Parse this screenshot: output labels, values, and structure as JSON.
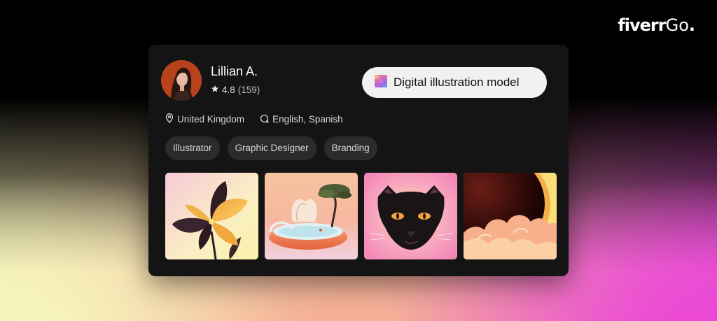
{
  "brand": {
    "name": "fiverr",
    "suffix": "Go",
    "dot": "."
  },
  "profile": {
    "name": "Lillian A.",
    "rating": "4.8",
    "reviews": "(159)",
    "location": "United Kingdom",
    "languages": "English, Spanish",
    "tags": [
      "Illustrator",
      "Graphic Designer",
      "Branding"
    ]
  },
  "cta": {
    "label": "Digital illustration model",
    "icon": "model-gradient-icon"
  },
  "gallery": [
    {
      "icon": "flower-illustration"
    },
    {
      "icon": "shell-tree-illustration"
    },
    {
      "icon": "panther-illustration"
    },
    {
      "icon": "sunset-clouds-illustration"
    }
  ],
  "colors": {
    "card": "#141414",
    "cta_bg": "#f1f1f1",
    "tag_bg": "#2b2b2b",
    "accent_pink": "#e65ad2",
    "accent_cream": "#efe9b3"
  }
}
